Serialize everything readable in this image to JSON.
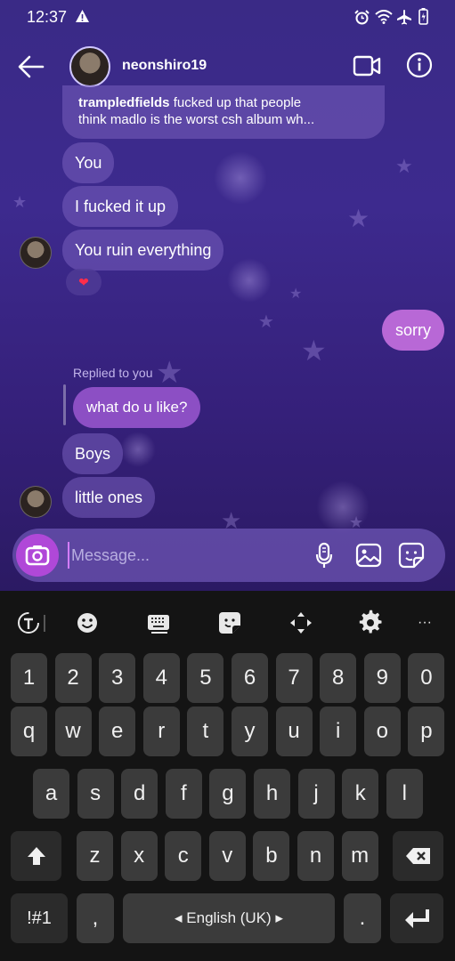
{
  "status": {
    "time": "12:37"
  },
  "header": {
    "username": "neonshiro19"
  },
  "messages": {
    "quoted_sender": "trampledfields",
    "quoted_text_1": " fucked up that people",
    "quoted_text_2": "think madlo is the worst csh album wh...",
    "you": "You",
    "fucked": "I fucked it up",
    "ruin": "You ruin everything",
    "reaction": "❤",
    "sorry": "sorry",
    "replied_label": "Replied to you",
    "what": "what do u like?",
    "boys": "Boys",
    "little": "little ones"
  },
  "composer": {
    "placeholder": "Message..."
  },
  "keyboard": {
    "row_numbers": [
      "1",
      "2",
      "3",
      "4",
      "5",
      "6",
      "7",
      "8",
      "9",
      "0"
    ],
    "row_q": [
      "q",
      "w",
      "e",
      "r",
      "t",
      "y",
      "u",
      "i",
      "o",
      "p"
    ],
    "row_a": [
      "a",
      "s",
      "d",
      "f",
      "g",
      "h",
      "j",
      "k",
      "l"
    ],
    "row_z": [
      "z",
      "x",
      "c",
      "v",
      "b",
      "n",
      "m"
    ],
    "symbols": "!#1",
    "comma": ",",
    "space": "◂ English (UK) ▸",
    "period": ".",
    "toolbar_more": "···"
  },
  "colors": {
    "sent_bubble": "#b868d6",
    "reply_bubble": "#8c4fc4",
    "camera": "#b048d8"
  }
}
